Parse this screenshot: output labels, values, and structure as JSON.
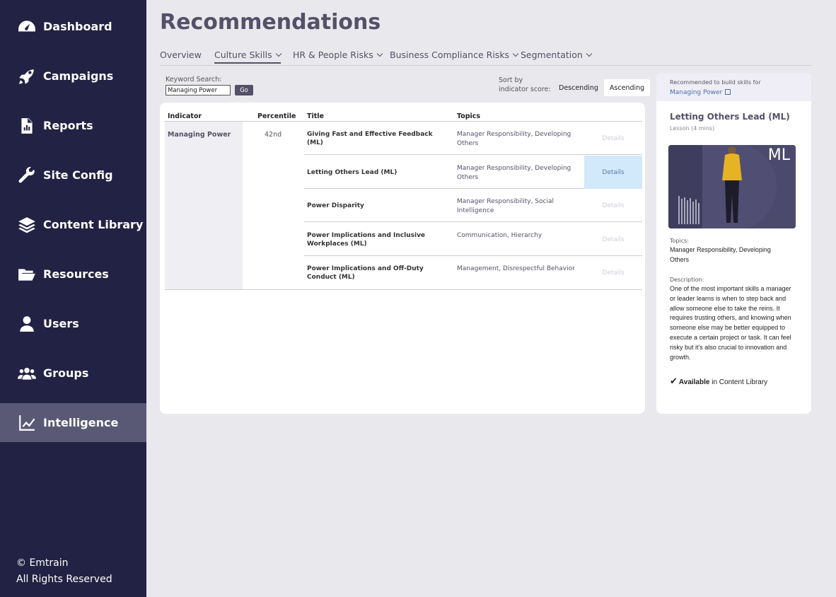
{
  "sidebar": {
    "items": [
      {
        "label": "Dashboard",
        "icon": "gauge-icon"
      },
      {
        "label": "Campaigns",
        "icon": "rocket-icon"
      },
      {
        "label": "Reports",
        "icon": "report-icon"
      },
      {
        "label": "Site Config",
        "icon": "wrench-icon"
      },
      {
        "label": "Content Library",
        "icon": "layers-icon"
      },
      {
        "label": "Resources",
        "icon": "folder-icon"
      },
      {
        "label": "Users",
        "icon": "user-icon"
      },
      {
        "label": "Groups",
        "icon": "group-icon"
      },
      {
        "label": "Intelligence",
        "icon": "chart-line-icon",
        "active": true
      }
    ],
    "footer": {
      "line1": "© Emtrain",
      "line2": "All Rights Reserved"
    }
  },
  "page": {
    "title": "Recommendations"
  },
  "tabs": [
    {
      "label": "Overview"
    },
    {
      "label": "Culture Skills",
      "active": true
    },
    {
      "label": "HR & People Risks"
    },
    {
      "label": "Business Compliance Risks"
    },
    {
      "label": "Segmentation"
    }
  ],
  "search": {
    "label": "Keyword Search:",
    "value": "Managing Power",
    "go_label": "Go"
  },
  "sort": {
    "label_line1": "Sort by",
    "label_line2": "indicator score:",
    "descending": "Descending",
    "ascending": "Ascending",
    "selected": "Descending"
  },
  "table": {
    "headers": {
      "indicator": "Indicator",
      "percentile": "Percentile",
      "title": "Title",
      "topics": "Topics"
    },
    "indicator": "Managing Power",
    "percentile": "42nd",
    "rows": [
      {
        "title": "Giving Fast and Effective Feedback (ML)",
        "topics": "Manager Responsibility, Developing Others",
        "details": "Details"
      },
      {
        "title": "Letting Others Lead (ML)",
        "topics": "Manager Responsibility, Developing Others",
        "details": "Details"
      },
      {
        "title": "Power Disparity",
        "topics": "Manager Responsibility, Social Intelligence",
        "details": "Details"
      },
      {
        "title": "Power Implications and Inclusive Workplaces (ML)",
        "topics": "Communication, Hierarchy",
        "details": "Details"
      },
      {
        "title": "Power Implications and Off-Duty Conduct (ML)",
        "topics": "Management, Disrespectful Behavior",
        "details": "Details"
      }
    ]
  },
  "detail": {
    "recommended_label": "Recommended to build skills for",
    "recommended_link": "Managing Power",
    "title": "Letting Others Lead (ML)",
    "subtitle": "Lesson (4 mins)",
    "thumb_badge": "ML",
    "topics_label": "Topics:",
    "topics": "Manager Responsibility, Developing Others",
    "description_label": "Description:",
    "description": "One of the most important skills a manager or leader learns is when to step back and allow someone else to take the reins. It requires trusting others, and knowing when someone else may be better equipped to execute a certain project or task. It can feel risky but it's also crucial to innovation and growth.",
    "available_bold": "Available",
    "available_rest": " in Content Library"
  }
}
